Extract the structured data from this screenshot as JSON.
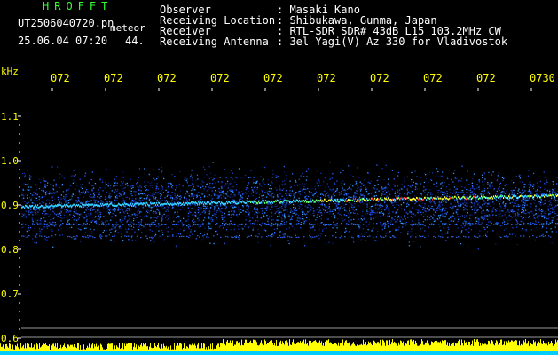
{
  "header": {
    "app_name": "HROFFT",
    "filename": "UT2506040720.pn",
    "meteor_label": "meteor",
    "datetime": "25.06.04 07:20",
    "count": "44.",
    "info_labels": [
      "Observer",
      "Receiving Location",
      "Receiver",
      "Receiving Antenna"
    ],
    "info_values": [
      ": Masaki Kano",
      ": Shibukawa, Gunma, Japan",
      ": RTL-SDR SDR# 43dB L15 103.2MHz CW",
      ": 3el Yagi(V) Az 330 for Vladivostok"
    ]
  },
  "spectrogram": {
    "y_unit": "kHz",
    "y_ticks": [
      "1.1",
      "1.0",
      "0.9",
      "0.8",
      "0.7",
      "0.6"
    ],
    "time_ticks": [
      "072",
      "072",
      "072",
      "072",
      "072",
      "072",
      "072",
      "072",
      "072",
      "0730"
    ],
    "colors": {
      "background": "#000000",
      "axis": "#ffffff",
      "label": "#ffff00",
      "signal_low": "#1a3cff",
      "signal_high": "#ff0000",
      "meter_high": "#ffff00",
      "meter_low": "#00ccff"
    }
  }
}
